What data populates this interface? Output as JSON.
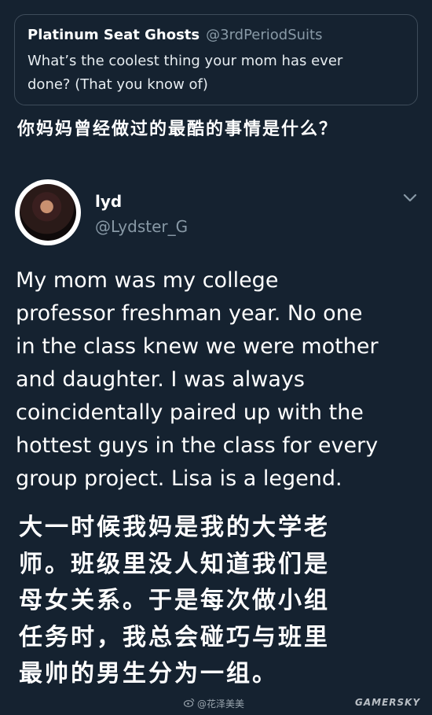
{
  "quoted_tweet": {
    "name": "Platinum Seat Ghosts",
    "handle": "@3rdPeriodSuits",
    "text_line1": "What’s the coolest thing your mom has ever",
    "text_line2": "done? (That you know of)"
  },
  "zh_caption": "你妈妈曾经做过的最酷的事情是什么？",
  "tweet": {
    "author_name": "lyd",
    "author_handle": "@Lydster_G",
    "chevron_icon": "chevron-down-icon",
    "body_lines": [
      "My mom was my college",
      "professor freshman year. No one",
      "in the class knew we were mother",
      "and daughter. I was always",
      "coincidentally paired up with the",
      "hottest guys in the class for every",
      "group project. Lisa is a legend."
    ]
  },
  "zh_translation_lines": [
    "大一时候我妈是我的大学老",
    "师。班级里没人知道我们是",
    "母女关系。于是每次做小组",
    "任务时，我总会碰巧与班里",
    "最帅的男生分为一组。"
  ],
  "watermarks": {
    "weibo_text": "@花泽美美",
    "weibo_icon": "weibo-icon",
    "gamersky_text": "GAMERSKY"
  },
  "colors": {
    "background": "#152230",
    "secondary_text": "#8899a6",
    "border": "#3e4c5a"
  }
}
